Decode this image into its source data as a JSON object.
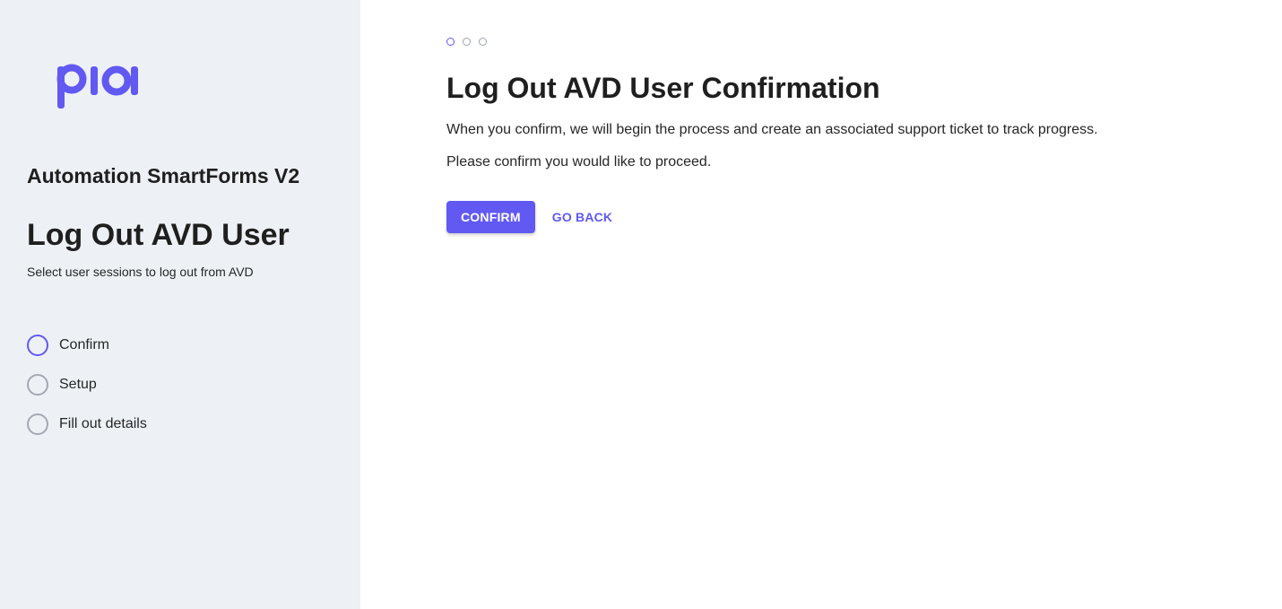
{
  "brand": {
    "logo_text": "pia",
    "accent_color": "#6159f2",
    "sidebar_bg": "#edf1f5"
  },
  "sidebar": {
    "app_title": "Automation SmartForms V2",
    "flow_title": "Log Out AVD User",
    "flow_subtitle": "Select user sessions to log out from AVD",
    "steps": [
      {
        "label": "Confirm",
        "active": true
      },
      {
        "label": "Setup",
        "active": false
      },
      {
        "label": "Fill out details",
        "active": false
      }
    ]
  },
  "main": {
    "progress": {
      "total_steps": 3,
      "current_step": 1
    },
    "title": "Log Out AVD User Confirmation",
    "description": "When you confirm, we will begin the process and create an associated support ticket to track progress.",
    "prompt": "Please confirm you would like to proceed.",
    "confirm_label": "CONFIRM",
    "back_label": "GO BACK"
  }
}
